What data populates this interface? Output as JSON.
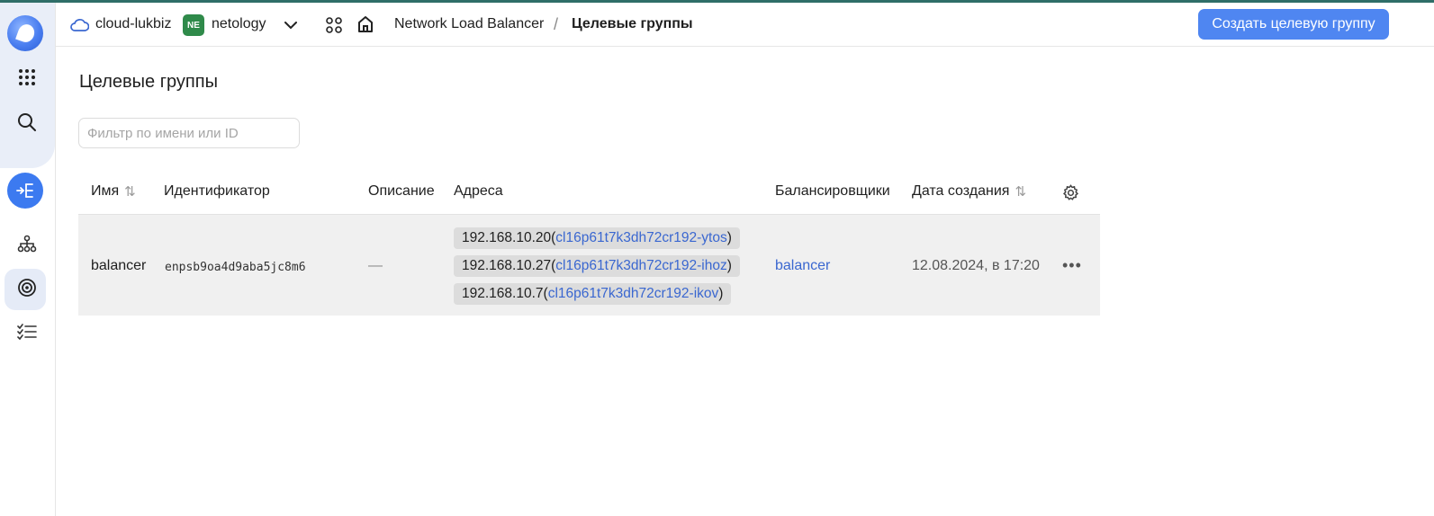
{
  "colors": {
    "accent": "#4f86f1",
    "link": "#3a67d0",
    "folder_badge": "#2f8a4a",
    "row_bg": "#f0f0f0"
  },
  "header": {
    "cloud_name": "cloud-lukbiz",
    "folder_badge": "NE",
    "folder_name": "netology",
    "breadcrumb_service": "Network Load Balancer",
    "breadcrumb_separator": "/",
    "breadcrumb_current": "Целевые группы",
    "create_button": "Создать целевую группу"
  },
  "sidebar": {
    "icons": [
      "logo-icon",
      "apps-grid-icon",
      "search-icon",
      "load-balancer-service-icon",
      "hierarchy-icon",
      "target-icon",
      "checklist-icon"
    ]
  },
  "page": {
    "title": "Целевые группы",
    "filter_placeholder": "Фильтр по имени или ID",
    "filter_value": ""
  },
  "table": {
    "columns": {
      "name": "Имя",
      "id": "Идентификатор",
      "description": "Описание",
      "addresses": "Адреса",
      "balancers": "Балансировщики",
      "created": "Дата создания"
    },
    "sort_glyph": "⇅",
    "rows": [
      {
        "name": "balancer",
        "id": "enpsb9oa4d9aba5jc8m6",
        "description": "—",
        "addresses": [
          {
            "ip": "192.168.10.20",
            "open": " (",
            "instance": "cl16p61t7k3dh72cr192-ytos",
            "close": ")"
          },
          {
            "ip": "192.168.10.27",
            "open": " (",
            "instance": "cl16p61t7k3dh72cr192-ihoz",
            "close": ")"
          },
          {
            "ip": "192.168.10.7",
            "open": " (",
            "instance": "cl16p61t7k3dh72cr192-ikov",
            "close": ")"
          }
        ],
        "balancer": "balancer",
        "created": "12.08.2024, в 17:20",
        "actions": "•••"
      }
    ]
  }
}
